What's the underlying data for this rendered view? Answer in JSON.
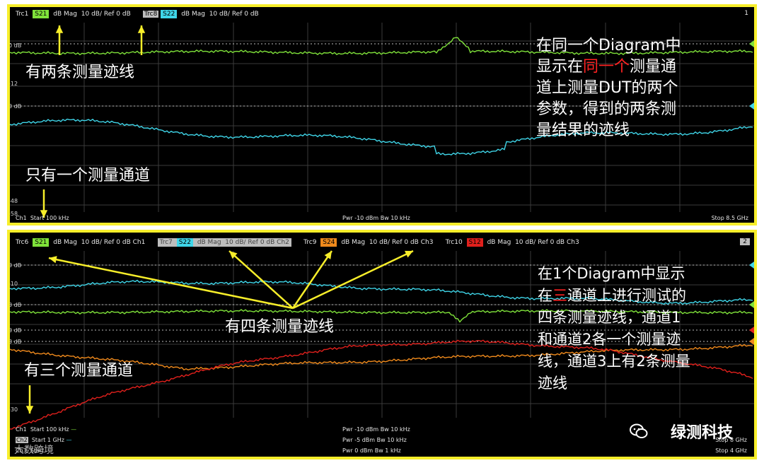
{
  "diagram1": {
    "number": "1",
    "traces": [
      {
        "name": "Trc1",
        "param": "S21",
        "format": "dB Mag",
        "scale": "10 dB/",
        "ref": "Ref 0 dB",
        "channel": "",
        "color": "#7fe23a"
      },
      {
        "name": "Trc8",
        "param": "S22",
        "format": "dB Mag",
        "scale": "10 dB/",
        "ref": "Ref 0 dB",
        "channel": "",
        "color": "#3fd5e8"
      }
    ],
    "ylabels": [
      "0 dB",
      "-12",
      "0 dB",
      "-48",
      "-58"
    ],
    "footer": {
      "channel": "Ch1",
      "start": "Start  100 kHz",
      "pwr": "Pwr  -10 dBm  Bw  10 kHz",
      "stop": "Stop  8.5 GHz"
    },
    "annotations": {
      "traces_label": "有两条测量迹线",
      "channel_label": "只有一个测量通道",
      "description_lines": [
        {
          "pre": "在同一个Diagram中",
          "hl": "",
          "post": ""
        },
        {
          "pre": "显示在",
          "hl": "同一个",
          "post": "测量通"
        },
        {
          "pre": "道上测量DUT的两个",
          "hl": "",
          "post": ""
        },
        {
          "pre": "参数，得到的两条测",
          "hl": "",
          "post": ""
        },
        {
          "pre": "量结果的迹线",
          "hl": "",
          "post": ""
        }
      ]
    }
  },
  "diagram2": {
    "number": "2",
    "traces": [
      {
        "name": "Trc6",
        "param": "S21",
        "format": "dB Mag",
        "scale": "10 dB/",
        "ref": "Ref 0 dB",
        "channel": "Ch1",
        "color": "#7fe23a"
      },
      {
        "name": "Trc7",
        "param": "S22",
        "format": "dB Mag",
        "scale": "10 dB/",
        "ref": "Ref 0 dB",
        "channel": "Ch2",
        "color": "#3fd5e8"
      },
      {
        "name": "Trc9",
        "param": "S24",
        "format": "dB Mag",
        "scale": "10 dB/",
        "ref": "Ref 0 dB",
        "channel": "Ch3",
        "color": "#f08a1c"
      },
      {
        "name": "Trc10",
        "param": "S12",
        "format": "dB Mag",
        "scale": "10 dB/",
        "ref": "Ref 0 dB",
        "channel": "Ch3",
        "color": "#e0201c"
      }
    ],
    "ylabels": [
      "0 dB",
      "-10",
      "0 dB",
      "0 dB",
      "0 dB",
      "-30"
    ],
    "footer": [
      {
        "channel": "Ch1",
        "start": "Start  100 kHz",
        "pwr": "Pwr  -10 dBm  Bw  10 kHz",
        "stop": ""
      },
      {
        "channel": "Ch2",
        "start": "Start  1 GHz",
        "pwr": "Pwr  -5 dBm  Bw  10 kHz",
        "stop": "Stop  8 GHz"
      },
      {
        "channel": "Ch3",
        "start": "Start",
        "pwr": "Pwr  0 dBm  Bw  1 kHz",
        "stop": "Stop  4 GHz"
      }
    ],
    "annotations": {
      "traces_label": "有四条测量迹线",
      "channel_label": "有三个测量通道",
      "description_lines": [
        {
          "pre": "在1个Diagram中显示",
          "hl": "",
          "post": ""
        },
        {
          "pre": "在",
          "hl": "三",
          "post": "通道上进行测试的"
        },
        {
          "pre": "四条测量迹线，通道1",
          "hl": "",
          "post": ""
        },
        {
          "pre": "和通道2各一个测量迹",
          "hl": "",
          "post": ""
        },
        {
          "pre": "线，通道3上有2条测量",
          "hl": "",
          "post": ""
        },
        {
          "pre": "迹线",
          "hl": "",
          "post": ""
        }
      ]
    }
  },
  "watermark": {
    "brand": "绿测科技",
    "source": "大数跨境"
  },
  "colors": {
    "border": "#f7ee2a",
    "arrow": "#f7ee2a",
    "grid": "#3a3a3a",
    "highlight": "#ff2222"
  }
}
